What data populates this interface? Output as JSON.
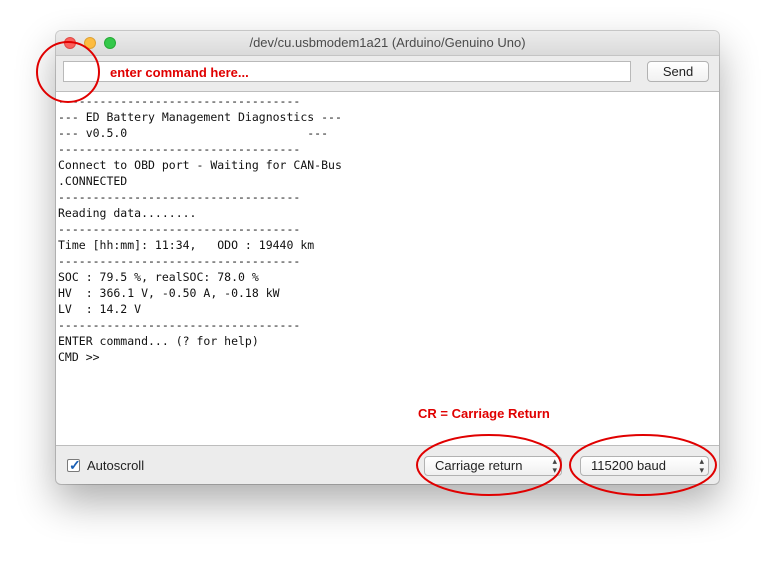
{
  "window": {
    "title": "/dev/cu.usbmodem1a21 (Arduino/Genuino Uno)"
  },
  "command_bar": {
    "input_value": "",
    "annotation_hint": "enter command here...",
    "send_label": "Send"
  },
  "console": {
    "lines": [
      "-----------------------------------",
      "--- ED Battery Management Diagnostics ---",
      "--- v0.5.0                          ---",
      "-----------------------------------",
      "Connect to OBD port - Waiting for CAN-Bus",
      ".CONNECTED",
      "-----------------------------------",
      "Reading data........",
      "-----------------------------------",
      "Time [hh:mm]: 11:34,   ODO : 19440 km",
      "-----------------------------------",
      "SOC : 79.5 %, realSOC: 78.0 %",
      "HV  : 366.1 V, -0.50 A, -0.18 kW",
      "LV  : 14.2 V",
      "-----------------------------------",
      "ENTER command... (? for help)",
      "CMD >>"
    ]
  },
  "annotations": {
    "cr_note": "CR = Carriage Return",
    "highlight_color": "#e00000"
  },
  "footer": {
    "autoscroll_label": "Autoscroll",
    "autoscroll_checked": true,
    "line_ending_value": "Carriage return",
    "baud_value": "115200 baud"
  },
  "icons": {
    "checkbox": "checkmark-icon",
    "select_arrows": "up-down-chevron-icon",
    "window_controls": [
      "close-icon",
      "minimize-icon",
      "zoom-icon"
    ]
  }
}
